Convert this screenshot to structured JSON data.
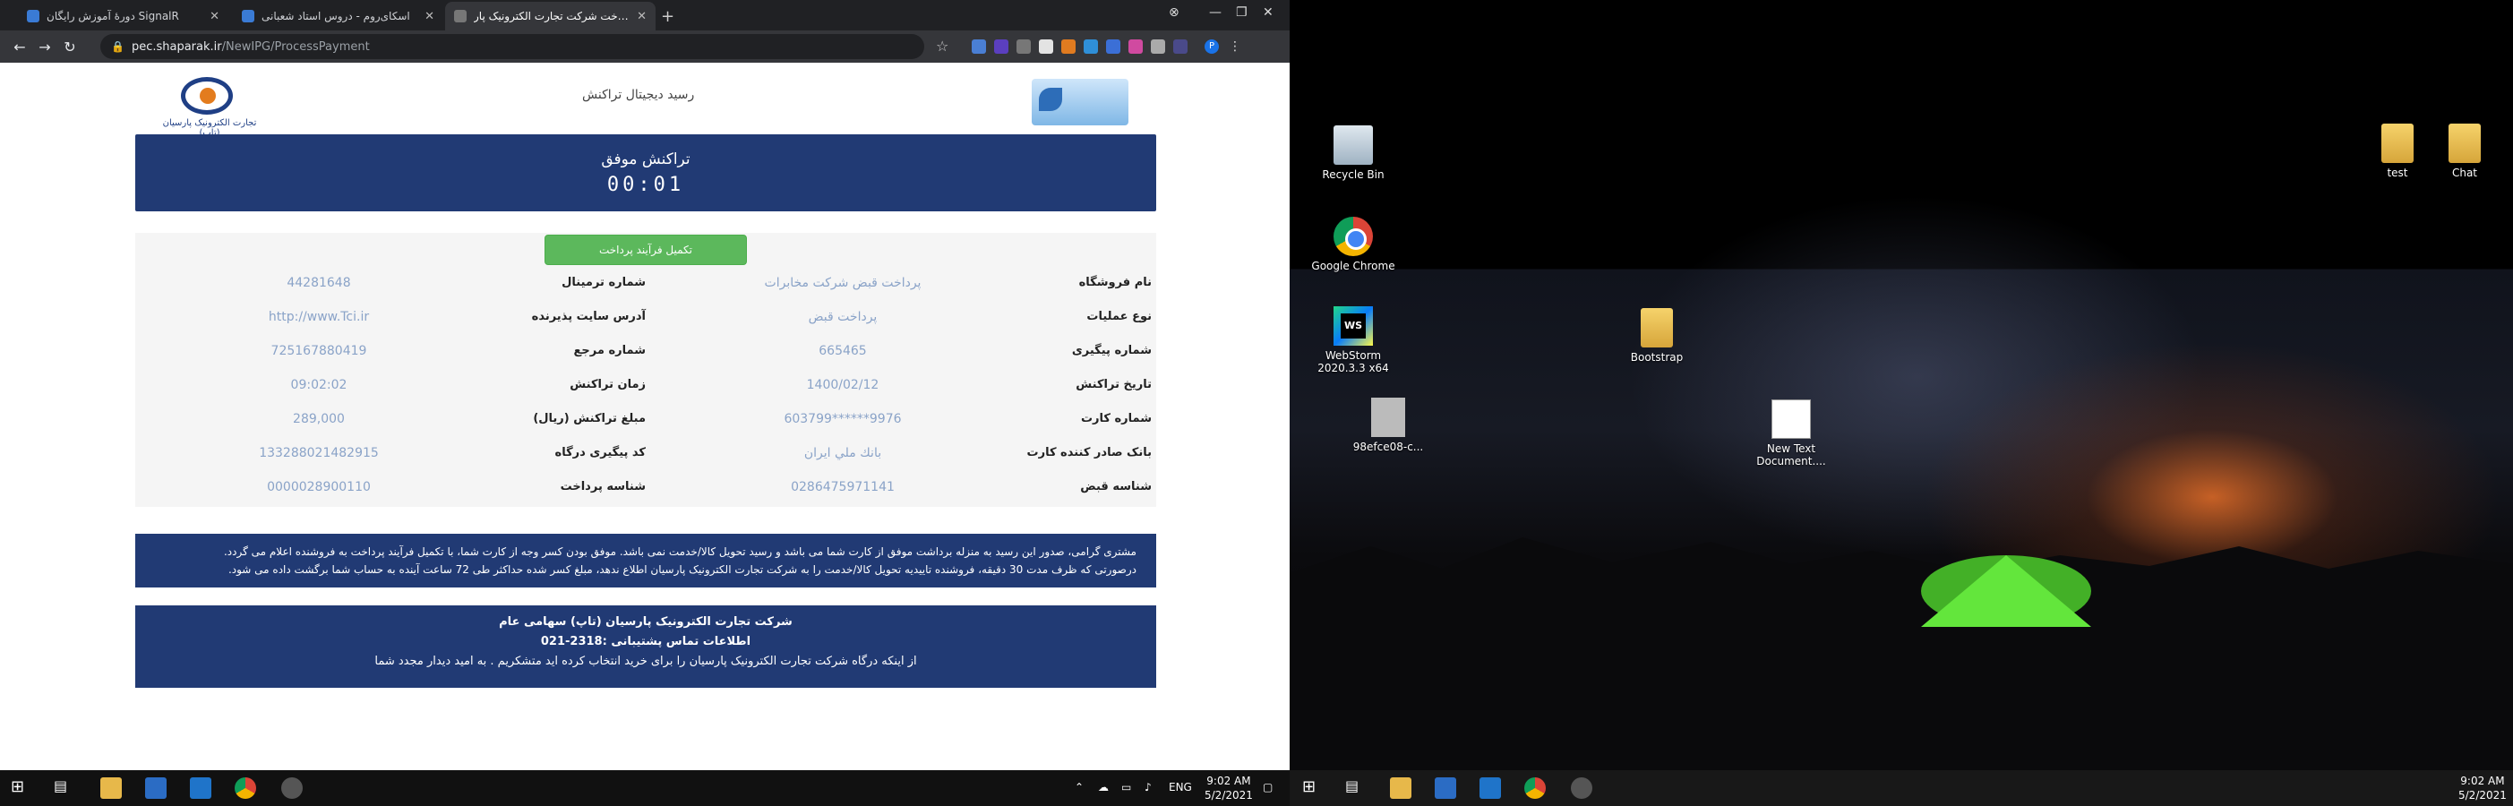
{
  "browser": {
    "tabs": [
      {
        "title": "دورهٔ آموزش رایگان SignalR"
      },
      {
        "title": "اسکای‌روم - دروس استاد شعبانی"
      },
      {
        "title": "پرداخت شرکت تجارت الکترونیک پار..."
      }
    ],
    "url_host": "pec.shaparak.ir",
    "url_path": "/NewIPG/ProcessPayment"
  },
  "page": {
    "header_title": "رسید دیجیتال تراکنش",
    "logo_text": "تجارت الکترونیک پارسیان (تاپ)",
    "status": "تراکنش موفق",
    "timer": "00:01",
    "complete_button": "تکمیل فرآیند پرداخت",
    "right_rows": [
      {
        "label": "نام فروشگاه",
        "value": "پرداخت قبض شرکت مخابرات"
      },
      {
        "label": "نوع عملیات",
        "value": "پرداخت قبض"
      },
      {
        "label": "شماره پیگیری",
        "value": "665465"
      },
      {
        "label": "تاریخ تراکنش",
        "value": "1400/02/12"
      },
      {
        "label": "شماره کارت",
        "value": "603799******9976"
      },
      {
        "label": "بانک صادر کننده کارت",
        "value": "بانك ملي ايران"
      },
      {
        "label": "شناسه قبض",
        "value": "0286475971141"
      }
    ],
    "left_rows": [
      {
        "label": "شماره ترمینال",
        "value": "44281648"
      },
      {
        "label": "آدرس سایت پذیرنده",
        "value": "http://www.Tci.ir"
      },
      {
        "label": "شماره مرجع",
        "value": "725167880419"
      },
      {
        "label": "زمان تراکنش",
        "value": "09:02:02"
      },
      {
        "label": "مبلغ تراکنش (ریال)",
        "value": "289,000"
      },
      {
        "label": "کد پیگیری درگاه",
        "value": "133288021482915"
      },
      {
        "label": "شناسه پرداخت",
        "value": "0000028900110"
      }
    ],
    "note_line1": "مشتری گرامی، صدور این رسید به منزله برداشت موفق از کارت شما می باشد و رسید تحویل کالا/خدمت نمی باشد. موفق بودن کسر وجه از کارت شما، با تکمیل فرآیند پرداخت به فروشنده اعلام می گردد.",
    "note_line2": "درصورتی که ظرف مدت 30 دقیقه، فروشنده تاییدیه تحویل کالا/خدمت را به شرکت تجارت الکترونیک پارسیان اطلاع ندهد، مبلغ کسر شده حداکثر طی 72 ساعت آینده به حساب شما برگشت داده می شود.",
    "footer_line1": "شرکت تجارت الکترونیک پارسیان (تاپ) سهامی عام",
    "footer_line2": "اطلاعات تماس پشتیبانی :2318-021",
    "footer_line3": "از اینکه درگاه شرکت تجارت الکترونیک پارسیان را برای خرید انتخاب کرده اید متشکریم . به امید دیدار مجدد شما"
  },
  "taskbar_left": {
    "lang": "ENG",
    "time": "9:02 AM",
    "date": "5/2/2021"
  },
  "desktop": {
    "icons": [
      {
        "label": "Recycle Bin",
        "type": "bin"
      },
      {
        "label": "Google Chrome",
        "type": "chrome"
      },
      {
        "label": "WebStorm 2020.3.3 x64",
        "type": "ws"
      },
      {
        "label": "98efce08-c...",
        "type": "gray"
      },
      {
        "label": "Bootstrap",
        "type": "folder"
      },
      {
        "label": "New Text Document....",
        "type": "file"
      },
      {
        "label": "test",
        "type": "folder"
      },
      {
        "label": "Chat",
        "type": "folder"
      }
    ]
  },
  "taskbar_right": {
    "time": "9:02 AM",
    "date": "5/2/2021"
  }
}
